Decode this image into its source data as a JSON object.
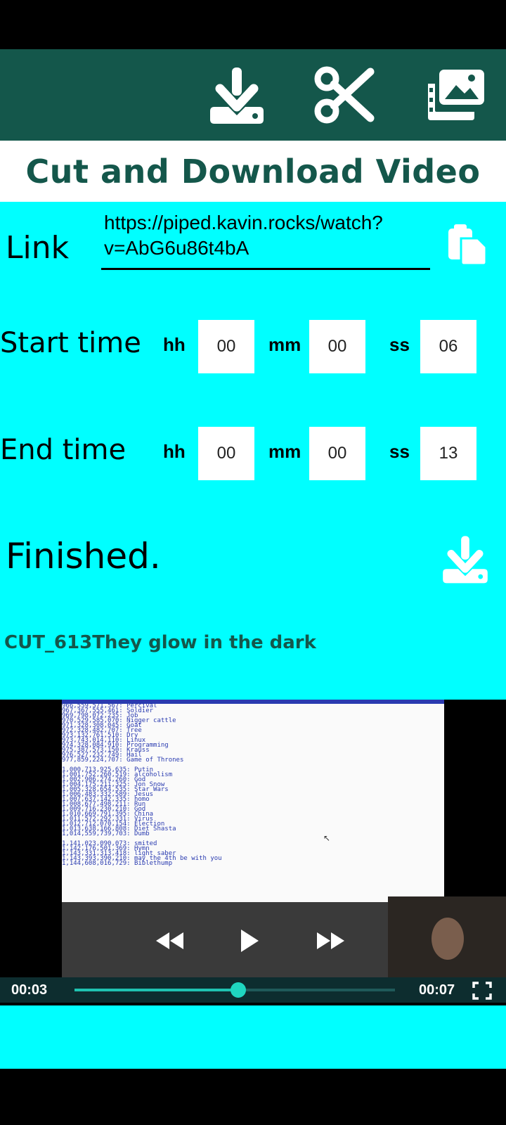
{
  "toolbar": {
    "icons": [
      "download-icon",
      "scissors-icon",
      "gallery-icon"
    ]
  },
  "title": "Cut and Download Video",
  "link": {
    "label": "Link",
    "value_line1": "https://piped.kavin.rocks/watch?",
    "value_line2": "v=AbG6u86t4bA"
  },
  "start_time": {
    "label": "Start time",
    "hh_label": "hh",
    "hh": "00",
    "mm_label": "mm",
    "mm": "00",
    "ss_label": "ss",
    "ss": "06"
  },
  "end_time": {
    "label": "End time",
    "hh_label": "hh",
    "hh": "00",
    "mm_label": "mm",
    "mm": "00",
    "ss_label": "ss",
    "ss": "13"
  },
  "status": "Finished.",
  "filename": "CUT_613They glow in the dark",
  "video": {
    "screen_lines": [
      "966,559,571,567: Percival",
      "967,367,555,461: Soldier",
      "969,798,072,235: Job",
      "970,529,585,070: Nigger cattle",
      "971,328,308,045: Goat",
      "972,328,482,707: Tree",
      "973,132,761,510: Dry",
      "973,743,014,110: Linux",
      "974,328,084,910: Programming",
      "975,387,573,150: Krauss",
      "976,527,232,749: Hail",
      "977,859,224,707: Game of Thrones",
      "",
      "1,000,713,925,635: Putin",
      "1,001,752,260,519: alcoholism",
      "1,002,906,274,260: God",
      "1,004,175,211,325: Jon Snow",
      "1,005,328,654,535: Star Wars",
      "1,006,483,332,589: Jesus",
      "1,007,637,142,335: homo",
      "1,008,677,498,211: Run",
      "1,009,716,230,210: God",
      "1,010,669,791,395: China",
      "1,011,572,292,331: Virus",
      "1,012,712,070,154: Election",
      "1,013,638,166,808: Diet Shasta",
      "1,014,559,739,703: Dumb",
      "",
      "1,141,023,090,073: smited",
      "1,142,176,501,369: Hymn",
      "1,143,331,313,418: light saber",
      "1,143,393,390,210: may the 4th be with you",
      "1,144,608,016,729: Biblethump"
    ],
    "time_current": "00:03",
    "time_total": "00:07",
    "progress": 0.51
  },
  "colors": {
    "toolbar": "#14574b",
    "panel": "#00ffff",
    "accent": "#1fc2b0"
  }
}
